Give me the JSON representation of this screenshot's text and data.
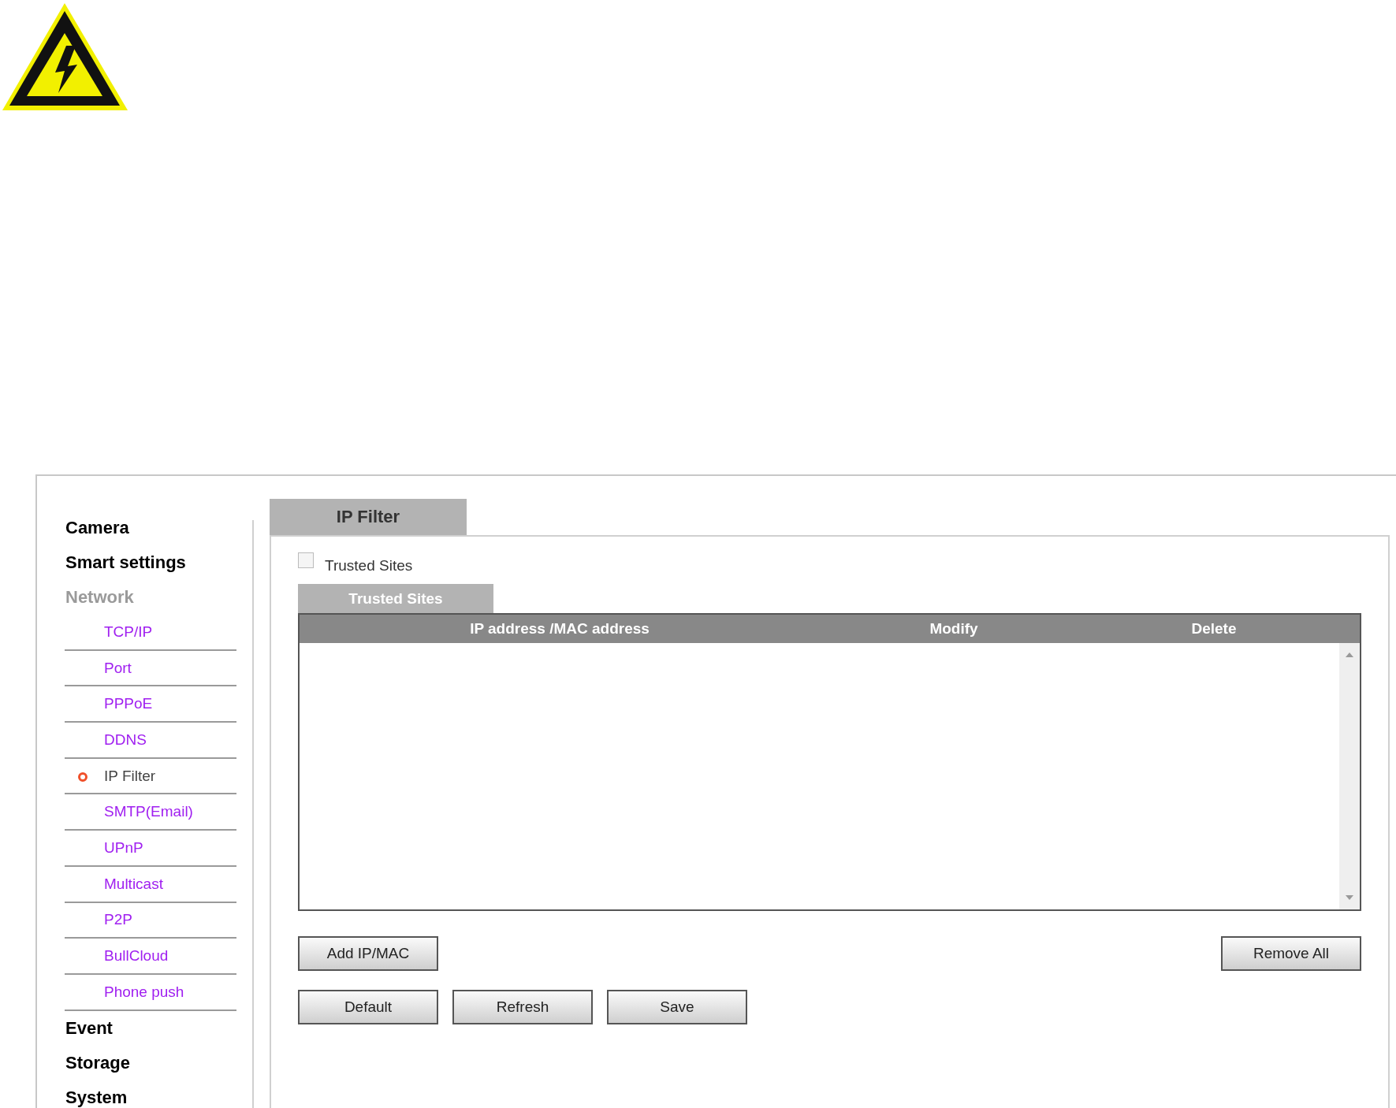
{
  "sidebar": {
    "sections": [
      {
        "label": "Camera",
        "selected": false
      },
      {
        "label": "Smart settings",
        "selected": false
      },
      {
        "label": "Network",
        "selected": true,
        "children": [
          {
            "label": "TCP/IP",
            "selected": false
          },
          {
            "label": "Port",
            "selected": false
          },
          {
            "label": "PPPoE",
            "selected": false
          },
          {
            "label": "DDNS",
            "selected": false
          },
          {
            "label": "IP Filter",
            "selected": true
          },
          {
            "label": "SMTP(Email)",
            "selected": false
          },
          {
            "label": "UPnP",
            "selected": false
          },
          {
            "label": "Multicast",
            "selected": false
          },
          {
            "label": "P2P",
            "selected": false
          },
          {
            "label": "BullCloud",
            "selected": false
          },
          {
            "label": "Phone push",
            "selected": false
          }
        ]
      },
      {
        "label": "Event",
        "selected": false
      },
      {
        "label": "Storage",
        "selected": false
      },
      {
        "label": "System",
        "selected": false
      }
    ]
  },
  "page_tab": {
    "label": "IP Filter"
  },
  "trusted_sites_checkbox": {
    "label": "Trusted Sites",
    "checked": false
  },
  "table_tab": {
    "label": "Trusted Sites"
  },
  "table": {
    "columns": [
      "IP address /MAC address",
      "Modify",
      "Delete"
    ]
  },
  "list_buttons": [
    "Add IP/MAC",
    "Remove All"
  ],
  "action_buttons": [
    "Default",
    "Refresh",
    "Save"
  ]
}
